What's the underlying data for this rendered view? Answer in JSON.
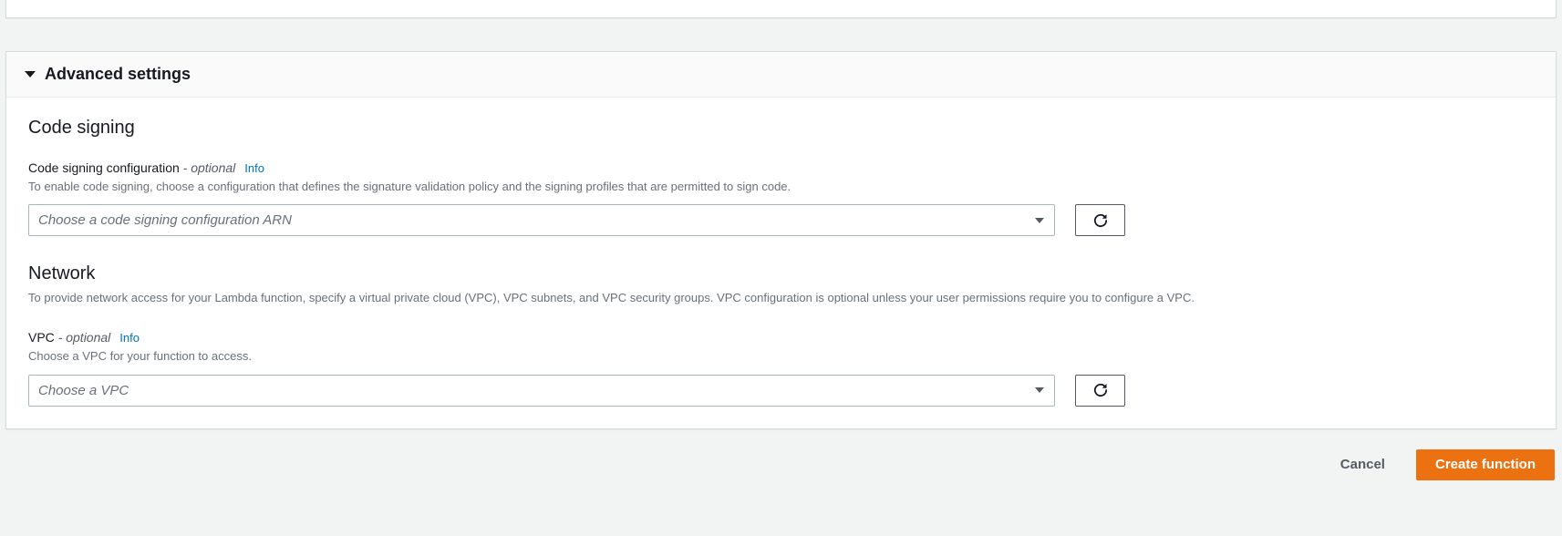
{
  "advanced": {
    "title": "Advanced settings",
    "code_signing": {
      "heading": "Code signing",
      "label": "Code signing configuration",
      "optional": "- optional",
      "info": "Info",
      "description": "To enable code signing, choose a configuration that defines the signature validation policy and the signing profiles that are permitted to sign code.",
      "placeholder": "Choose a code signing configuration ARN"
    },
    "network": {
      "heading": "Network",
      "description": "To provide network access for your Lambda function, specify a virtual private cloud (VPC), VPC subnets, and VPC security groups. VPC configuration is optional unless your user permissions require you to configure a VPC.",
      "vpc_label": "VPC",
      "optional": "- optional",
      "info": "Info",
      "vpc_description": "Choose a VPC for your function to access.",
      "placeholder": "Choose a VPC"
    }
  },
  "footer": {
    "cancel": "Cancel",
    "create": "Create function"
  }
}
